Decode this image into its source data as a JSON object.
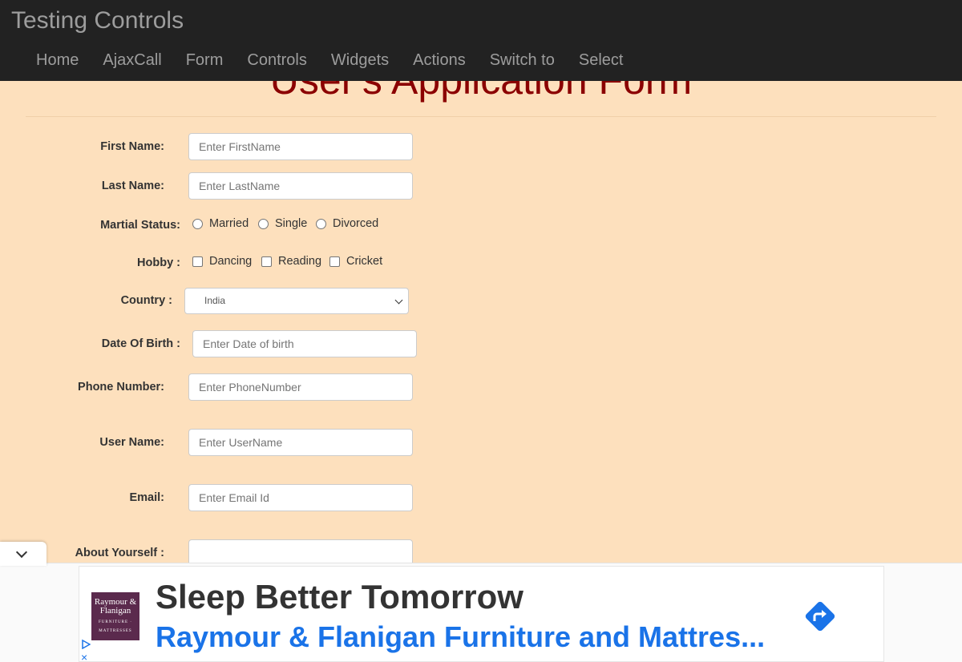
{
  "header": {
    "brand": "Testing Controls",
    "nav": [
      "Home",
      "AjaxCall",
      "Form",
      "Controls",
      "Widgets",
      "Actions",
      "Switch to",
      "Select"
    ]
  },
  "page": {
    "title": "User's Application Form"
  },
  "form": {
    "first_name": {
      "label": "First Name:",
      "placeholder": "Enter FirstName"
    },
    "last_name": {
      "label": "Last Name:",
      "placeholder": "Enter LastName"
    },
    "marital": {
      "label": "Martial Status:",
      "options": [
        "Married",
        "Single",
        "Divorced"
      ]
    },
    "hobby": {
      "label": "Hobby :",
      "options": [
        "Dancing",
        "Reading",
        "Cricket"
      ]
    },
    "country": {
      "label": "Country :",
      "value": "India"
    },
    "dob": {
      "label": "Date Of Birth :",
      "placeholder": "Enter Date of birth"
    },
    "phone": {
      "label": "Phone Number:",
      "placeholder": "Enter PhoneNumber"
    },
    "username": {
      "label": "User Name:",
      "placeholder": "Enter UserName"
    },
    "email": {
      "label": "Email:",
      "placeholder": "Enter Email Id"
    },
    "about": {
      "label": "About Yourself :"
    }
  },
  "ad": {
    "logo_text": "Raymour & Flanigan",
    "logo_sub": "FURNITURE · MATTRESSES",
    "headline": "Sleep Better Tomorrow",
    "subline": "Raymour & Flanigan Furniture and Mattres...",
    "close_glyph": "×",
    "accent": "#1a73e8"
  }
}
